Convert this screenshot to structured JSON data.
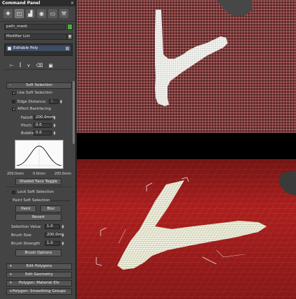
{
  "panel": {
    "title": "Command Panel",
    "tabs": [
      "create-icon",
      "modify-icon",
      "hierarchy-icon",
      "motion-icon",
      "display-icon",
      "utilities-icon"
    ],
    "object_name": "path_mesh",
    "object_color": "#45b035",
    "modifier_list": "Modifier List",
    "stack_item": "Editable Poly",
    "stack_tools": [
      "pin-stack-icon",
      "show-end-result-icon",
      "make-unique-icon",
      "remove-modifier-icon",
      "configure-icon"
    ]
  },
  "soft_selection": {
    "title": "Soft Selection",
    "use_soft_selection": "Use Soft Selection",
    "use_soft_selection_checked": true,
    "edge_distance": "Edge Distance:",
    "edge_distance_value": "1",
    "edge_distance_checked": false,
    "affect_backfacing": "Affect Backfacing",
    "affect_backfacing_checked": true,
    "falloff_label": "Falloff:",
    "falloff_value": "200.0mm",
    "pinch_label": "Pinch:",
    "pinch_value": "0.0",
    "bubble_label": "Bubble:",
    "bubble_value": "0.0",
    "curve_left": "200.0mm",
    "curve_mid": "0.0mm",
    "curve_right": "200.0mm",
    "shaded_face_toggle": "Shaded Face Toggle",
    "lock_soft_selection": "Lock Soft Selection",
    "paint_group": "Paint Soft Selection",
    "paint": "Paint",
    "blur": "Blur",
    "revert": "Revert",
    "selection_value_label": "Selection Value",
    "selection_value": "1.0",
    "brush_size_label": "Brush Size",
    "brush_size": "200.0m",
    "brush_strength_label": "Brush Strength",
    "brush_strength": "1.0",
    "brush_options": "Brush Options"
  },
  "rollouts": [
    "Edit Polygons",
    "Edit Geometry",
    "Polygon: Material IDs",
    "Polygon: Smoothing Groups"
  ],
  "colors": {
    "panel_bg": "#444444",
    "viewport_red": "#b01e1e",
    "selection_white": "#f2f2ea"
  }
}
